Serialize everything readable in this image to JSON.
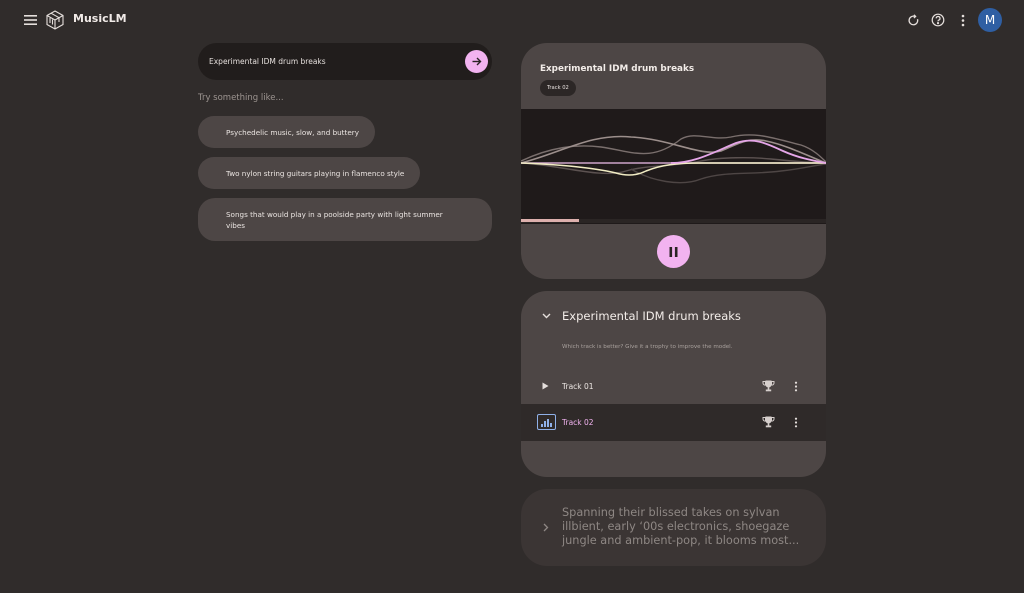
{
  "app": {
    "title": "MusicLM"
  },
  "colors": {
    "background": "#302c2b",
    "card": "#4d4645",
    "accent": "#f2b3f0",
    "avatar": "#2f5fa3"
  },
  "header": {
    "icons": [
      "menu-icon",
      "musiclm-logo-icon",
      "reset-icon",
      "help-icon",
      "more-vert-icon"
    ],
    "avatar_initial": "M"
  },
  "search": {
    "value": "Experimental IDM drum breaks"
  },
  "suggestions": {
    "label": "Try something like...",
    "items": [
      "Psychedelic music, slow, and buttery",
      "Two nylon string guitars playing in flamenco style",
      "Songs that would play in a poolside party with light summer vibes"
    ]
  },
  "player": {
    "title": "Experimental IDM drum breaks",
    "track_tag": "Track 02",
    "progress_fraction": 0.19,
    "state": "playing"
  },
  "results": {
    "title": "Experimental IDM drum breaks",
    "hint": "Which track is better? Give it a trophy to improve the model.",
    "tracks": [
      {
        "name": "Track 01",
        "selected": false
      },
      {
        "name": "Track 02",
        "selected": true
      }
    ]
  },
  "description": {
    "text": "Spanning their blissed takes on sylvan illbient, early ‘00s electronics, shoegaze jungle and ambient-pop, it blooms most..."
  }
}
